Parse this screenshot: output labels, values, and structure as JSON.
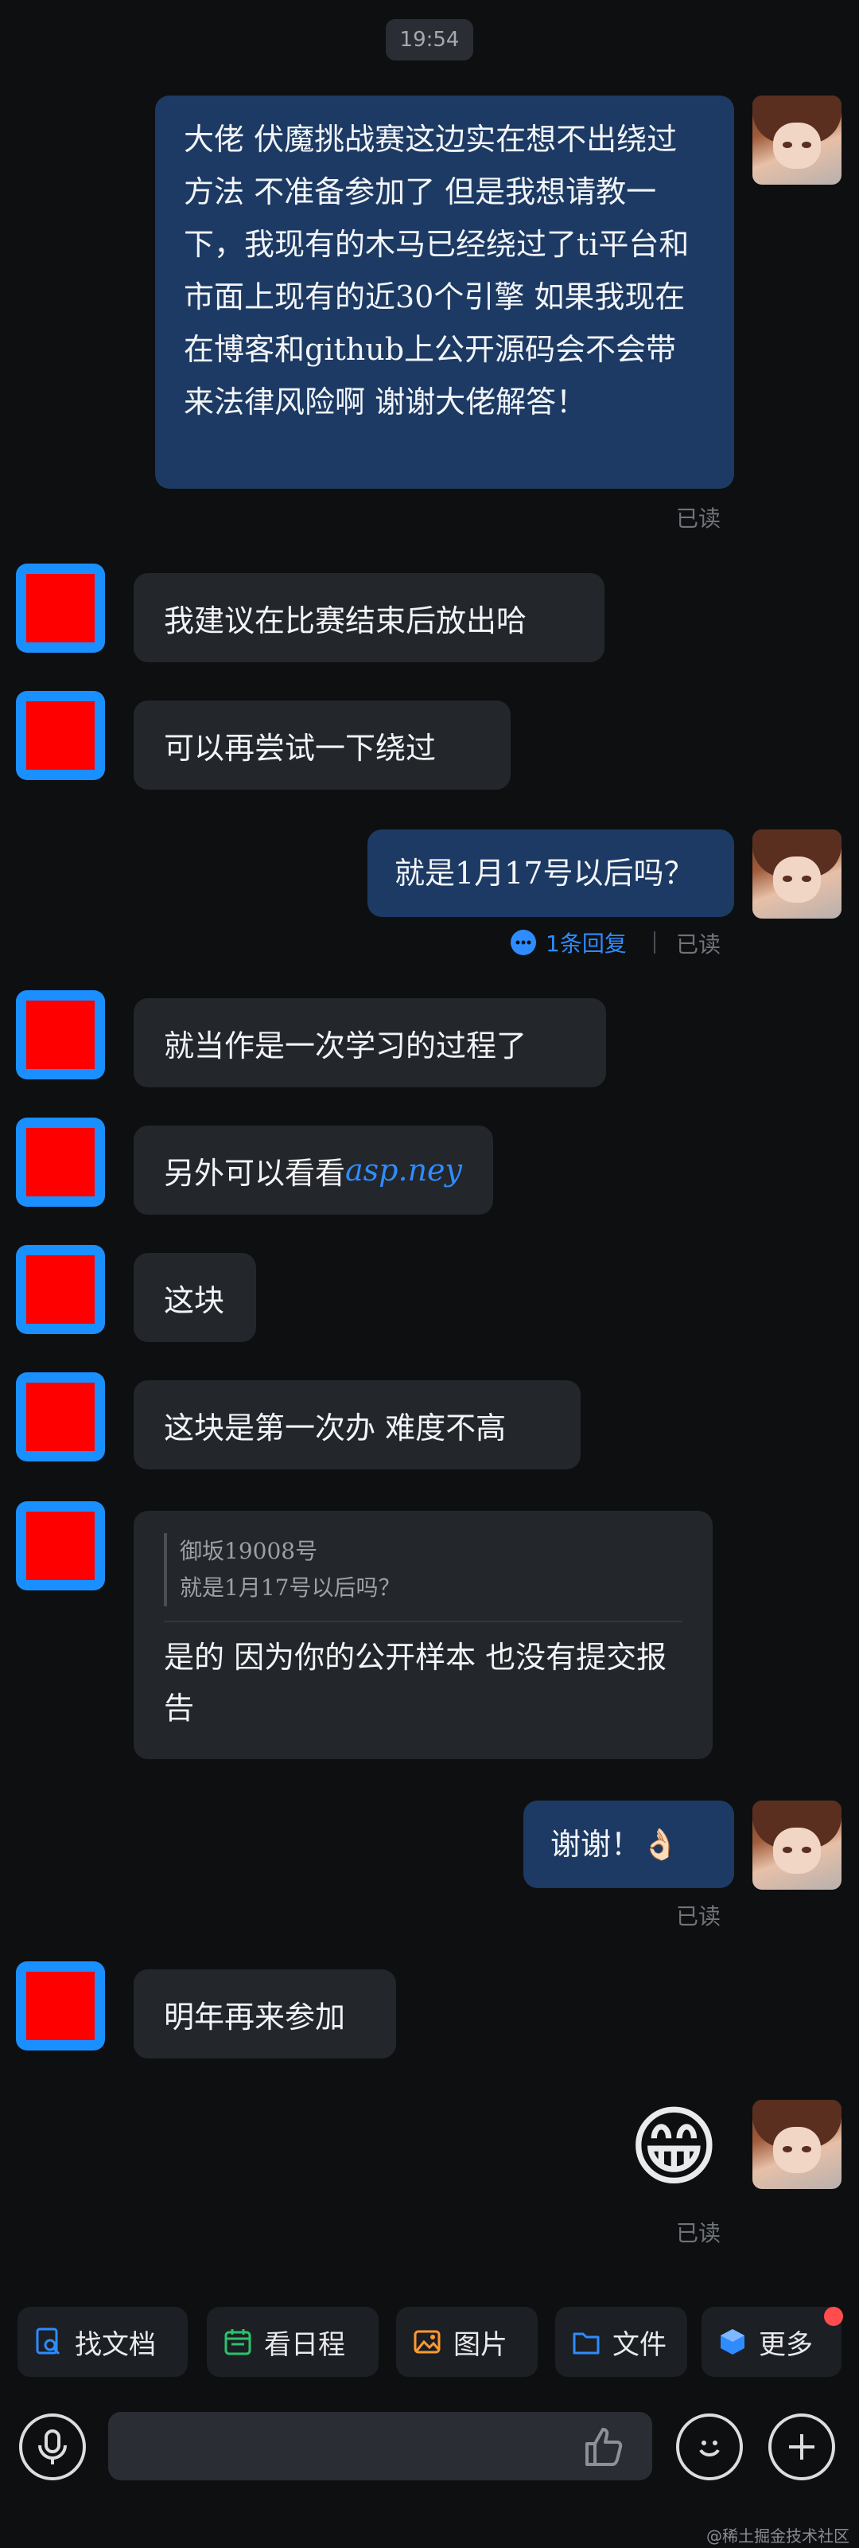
{
  "time": "19:54",
  "messages": {
    "m1": "大佬 伏魔挑战赛这边实在想不出绕过方法 不准备参加了 但是我想请教一下，我现有的木马已经绕过了ti平台和市面上现有的近30个引擎 如果我现在在博客和github上公开源码会不会带来法律风险啊 谢谢大佬解答！",
    "m2": "我建议在比赛结束后放出哈",
    "m3": "可以再尝试一下绕过",
    "m4": "就是1月17号以后吗？",
    "m5": "就当作是一次学习的过程了",
    "m6_prefix": "另外可以看看",
    "m6_link": "asp.ney",
    "m7": "这块",
    "m8": "这块是第一次办 难度不高",
    "m9_quote_author": "御坂19008号",
    "m9_quote_text": "就是1月17号以后吗？",
    "m9_reply": "是的 因为你的公开样本 也没有提交报告",
    "m10": "谢谢！👌🏻",
    "m11": "明年再来参加",
    "m12": "😁"
  },
  "read_label": "已读",
  "reply_count": "1条回复",
  "toolbar": {
    "find_doc": "找文档",
    "schedule": "看日程",
    "image": "图片",
    "file": "文件",
    "more": "更多"
  },
  "colors": {
    "bubble_me": "#1c3a63",
    "bubble_other": "#23262b",
    "accent": "#2e8cff",
    "badge": "#ff4d4f"
  },
  "watermark": "@稀土掘金技术社区"
}
